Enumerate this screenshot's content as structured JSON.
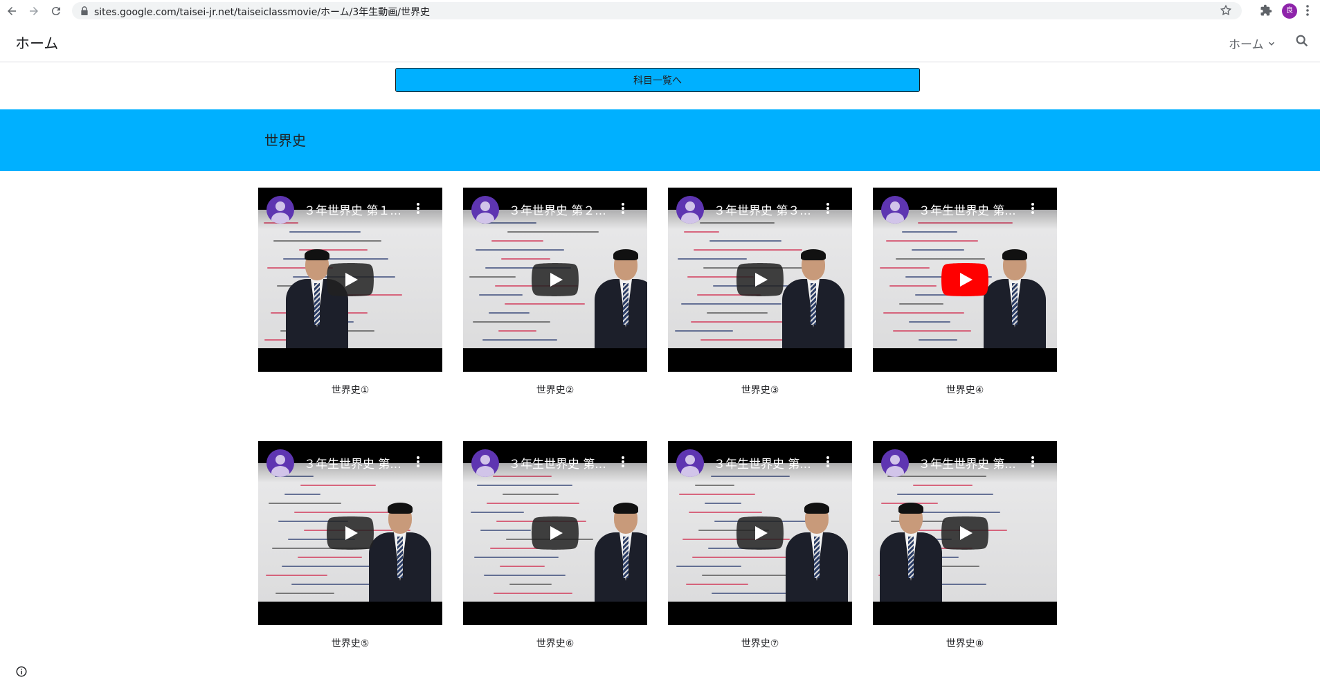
{
  "browser": {
    "url": "sites.google.com/taisei-jr.net/taiseiclassmovie/ホーム/3年生動画/世界史",
    "profile_initial": "良"
  },
  "header": {
    "site_title": "ホーム",
    "nav_label": "ホーム"
  },
  "subject_button": {
    "label": "科目一覧へ"
  },
  "banner": {
    "title": "世界史"
  },
  "videos": [
    {
      "title": "３年世界史 第１...",
      "caption": "世界史①",
      "play_style": "dark"
    },
    {
      "title": "３年世界史 第２...",
      "caption": "世界史②",
      "play_style": "dark"
    },
    {
      "title": "３年世界史 第３...",
      "caption": "世界史③",
      "play_style": "dark"
    },
    {
      "title": "３年生世界史 第...",
      "caption": "世界史④",
      "play_style": "red"
    },
    {
      "title": "３年生世界史 第...",
      "caption": "世界史⑤",
      "play_style": "dark"
    },
    {
      "title": "３年生世界史 第...",
      "caption": "世界史⑥",
      "play_style": "dark"
    },
    {
      "title": "３年生世界史 第...",
      "caption": "世界史⑦",
      "play_style": "dark"
    },
    {
      "title": "３年生世界史 第...",
      "caption": "世界史⑧",
      "play_style": "dark"
    }
  ],
  "colors": {
    "accent": "#00b0ff",
    "play_dark": "#212121",
    "play_red": "#ff0000"
  }
}
